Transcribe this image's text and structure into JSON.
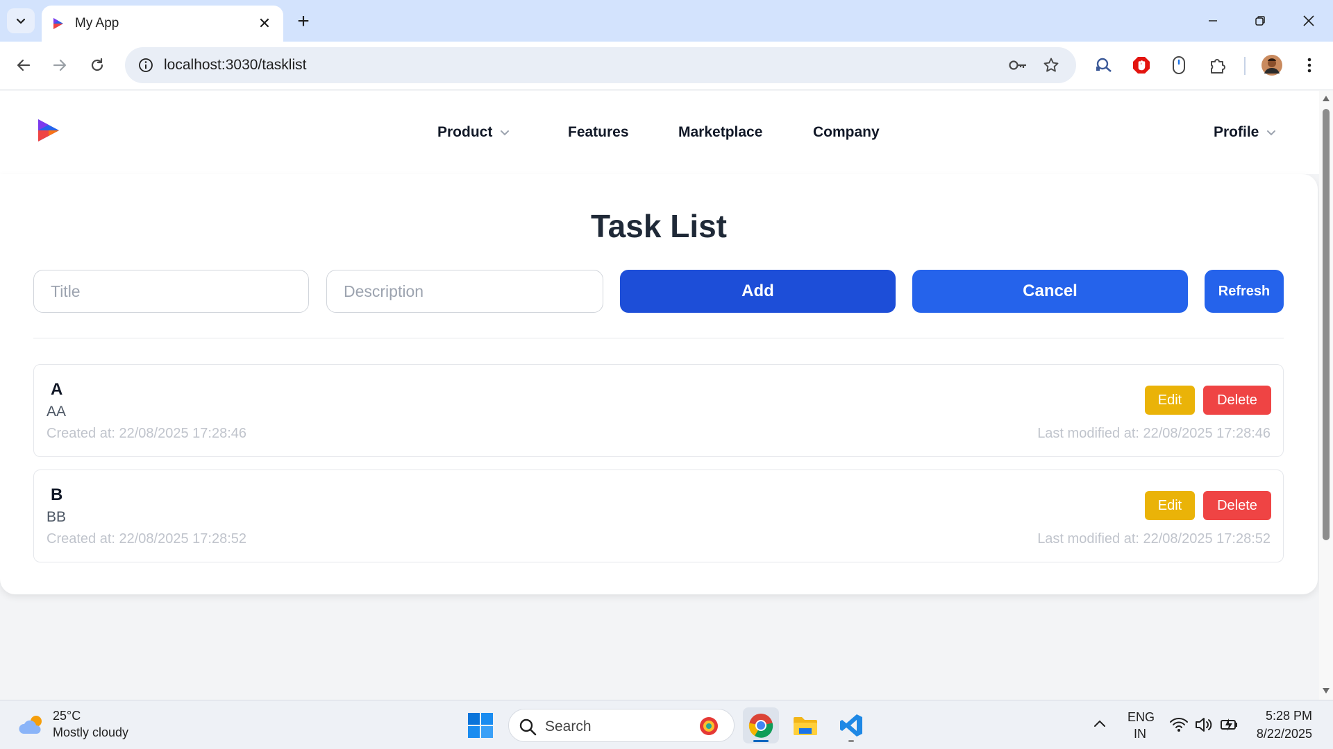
{
  "browser": {
    "tab_title": "My App",
    "url": "localhost:3030/tasklist"
  },
  "site": {
    "nav": {
      "product": "Product",
      "features": "Features",
      "marketplace": "Marketplace",
      "company": "Company",
      "profile": "Profile"
    }
  },
  "page": {
    "title": "Task List",
    "title_placeholder": "Title",
    "description_placeholder": "Description",
    "add_label": "Add",
    "cancel_label": "Cancel",
    "refresh_label": "Refresh"
  },
  "tasks": [
    {
      "title": "A",
      "description": "AA",
      "created": "Created at: 22/08/2025 17:28:46",
      "modified": "Last modified at: 22/08/2025 17:28:46",
      "edit_label": "Edit",
      "delete_label": "Delete"
    },
    {
      "title": "B",
      "description": "BB",
      "created": "Created at: 22/08/2025 17:28:52",
      "modified": "Last modified at: 22/08/2025 17:28:52",
      "edit_label": "Edit",
      "delete_label": "Delete"
    }
  ],
  "taskbar": {
    "weather_temp": "25°C",
    "weather_desc": "Mostly cloudy",
    "search_label": "Search",
    "lang_line1": "ENG",
    "lang_line2": "IN",
    "time": "5:28 PM",
    "date": "8/22/2025"
  },
  "icons": {
    "tab_favicon": "app-logo-icon",
    "omnibox": [
      "info-icon",
      "key-icon",
      "star-icon"
    ],
    "extensions": [
      "search-magnifier-icon",
      "adblock-icon",
      "mouse-icon",
      "puzzle-icon",
      "avatar"
    ]
  },
  "colors": {
    "primary_dark": "#1d4ed8",
    "primary": "#2563eb",
    "edit": "#eab308",
    "delete": "#ef4444",
    "tabstrip": "#d3e3fd"
  }
}
